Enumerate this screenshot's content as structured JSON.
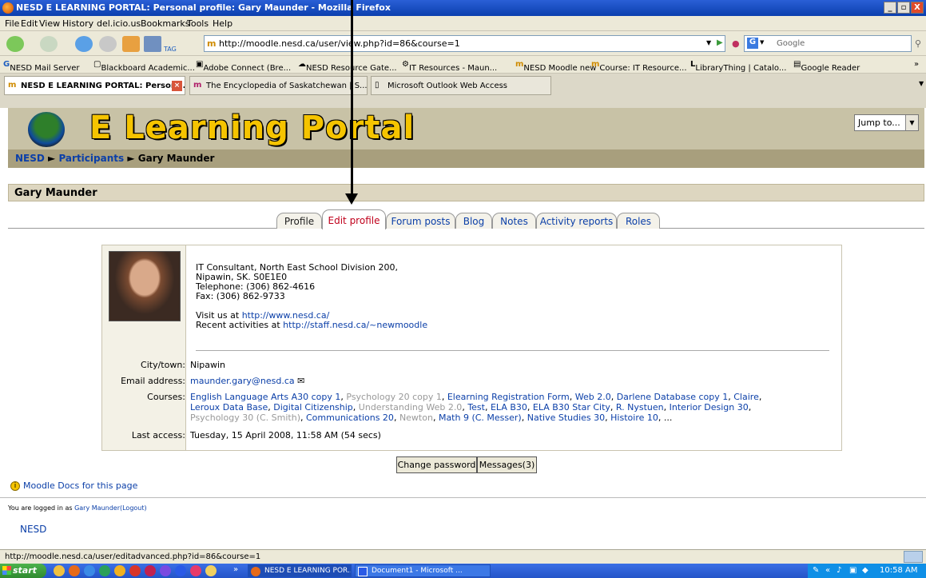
{
  "window": {
    "title": "NESD E LEARNING PORTAL: Personal profile: Gary Maunder - Mozilla Firefox",
    "controls": [
      "_",
      "▫",
      "X"
    ]
  },
  "menu": [
    "File",
    "Edit",
    "View",
    "History",
    "del.icio.us",
    "Bookmarks",
    "Tools",
    "Help"
  ],
  "browser": {
    "url": "http://moodle.nesd.ca/user/view.php?id=86&course=1",
    "tag_label": "TAG",
    "search_placeholder": "Google"
  },
  "bookmarks": [
    "NESD Mail Server",
    "Blackboard Academic...",
    "Adobe Connect (Bre...",
    "NESD Resource Gate...",
    "IT Resources - Maun...",
    "NESD Moodle new",
    "Course: IT Resource...",
    "LibraryThing | Catalo...",
    "Google Reader"
  ],
  "browser_tabs": [
    "NESD E LEARNING PORTAL: Person...",
    "The Encyclopedia of Saskatchewan | S...",
    "Microsoft Outlook Web Access"
  ],
  "site": {
    "logo_text": "E Learning Portal",
    "jump_label": "Jump to..."
  },
  "breadcrumb": {
    "home": "NESD",
    "sep1": "►",
    "participants": "Participants",
    "sep2": "►",
    "current": "Gary Maunder"
  },
  "page_heading": "Gary Maunder",
  "profile_tabs": [
    "Profile",
    "Edit profile",
    "Forum posts",
    "Blog",
    "Notes",
    "Activity reports",
    "Roles"
  ],
  "profile": {
    "desc_lines": [
      "IT Consultant, North East School Division 200,",
      "Nipawin, SK. S0E1E0",
      "Telephone: (306) 862-4616",
      "Fax: (306) 862-9733"
    ],
    "visit_prefix": "Visit us at ",
    "visit_link": "http://www.nesd.ca/",
    "recent_prefix": "Recent activities at ",
    "recent_link": "http://staff.nesd.ca/~newmoodle",
    "city_label": "City/town:",
    "city_value": "Nipawin",
    "email_label": "Email address:",
    "email_value": "maunder.gary@nesd.ca",
    "courses_label": "Courses:",
    "courses_line1": [
      {
        "t": "English Language Arts A30 copy 1",
        "c": "link"
      },
      {
        "t": ", ",
        "c": ""
      },
      {
        "t": "Psychology 20 copy 1",
        "c": "grey"
      },
      {
        "t": ", ",
        "c": ""
      },
      {
        "t": "Elearning Registration Form",
        "c": "link"
      },
      {
        "t": ", ",
        "c": ""
      },
      {
        "t": "Web 2.0",
        "c": "link"
      },
      {
        "t": ", ",
        "c": ""
      },
      {
        "t": "Darlene Database copy 1",
        "c": "link"
      },
      {
        "t": ", ",
        "c": ""
      },
      {
        "t": "Claire",
        "c": "link"
      },
      {
        "t": ",",
        "c": ""
      }
    ],
    "courses_line2": [
      {
        "t": "Leroux Data Base",
        "c": "link"
      },
      {
        "t": ", ",
        "c": ""
      },
      {
        "t": "Digital Citizenship",
        "c": "link"
      },
      {
        "t": ", ",
        "c": ""
      },
      {
        "t": "Understanding Web 2.0",
        "c": "grey"
      },
      {
        "t": ", ",
        "c": ""
      },
      {
        "t": "Test",
        "c": "link"
      },
      {
        "t": ", ",
        "c": ""
      },
      {
        "t": "ELA B30",
        "c": "link"
      },
      {
        "t": ", ",
        "c": ""
      },
      {
        "t": "ELA B30 Star City",
        "c": "link"
      },
      {
        "t": ", ",
        "c": ""
      },
      {
        "t": "R. Nystuen",
        "c": "link"
      },
      {
        "t": ", ",
        "c": ""
      },
      {
        "t": "Interior Design 30",
        "c": "link"
      },
      {
        "t": ",",
        "c": ""
      }
    ],
    "courses_line3": [
      {
        "t": "Psychology 30 (C. Smith)",
        "c": "grey"
      },
      {
        "t": ", ",
        "c": ""
      },
      {
        "t": "Communications 20",
        "c": "link"
      },
      {
        "t": ", ",
        "c": ""
      },
      {
        "t": "Newton",
        "c": "grey"
      },
      {
        "t": ", ",
        "c": ""
      },
      {
        "t": "Math 9 (C. Messer)",
        "c": "link"
      },
      {
        "t": ", ",
        "c": ""
      },
      {
        "t": "Native Studies 30",
        "c": "link"
      },
      {
        "t": ", ",
        "c": ""
      },
      {
        "t": "Histoire 10",
        "c": "link"
      },
      {
        "t": ", ...",
        "c": ""
      }
    ],
    "access_label": "Last access:",
    "access_value": "Tuesday, 15 April 2008, 11:58 AM  (54 secs)"
  },
  "buttons": {
    "change_password": "Change password",
    "messages": "Messages(3)"
  },
  "footer": {
    "docs_link": "Moodle Docs for this page",
    "logged_prefix": "You are logged in as ",
    "logged_user": "Gary Maunder",
    "logout": "(Logout)",
    "home_link": "NESD"
  },
  "status_url": "http://moodle.nesd.ca/user/editadvanced.php?id=86&course=1",
  "taskbar": {
    "start": "start",
    "tasks": [
      "NESD E LEARNING POR...",
      "Document1 - Microsoft ..."
    ],
    "overflow": "»",
    "clock": "10:58 AM"
  },
  "colors": {
    "link": "#0b3fa8",
    "active_tab": "#c0001b",
    "banner": "#c8c2a6",
    "navbar": "#a89f7d"
  }
}
